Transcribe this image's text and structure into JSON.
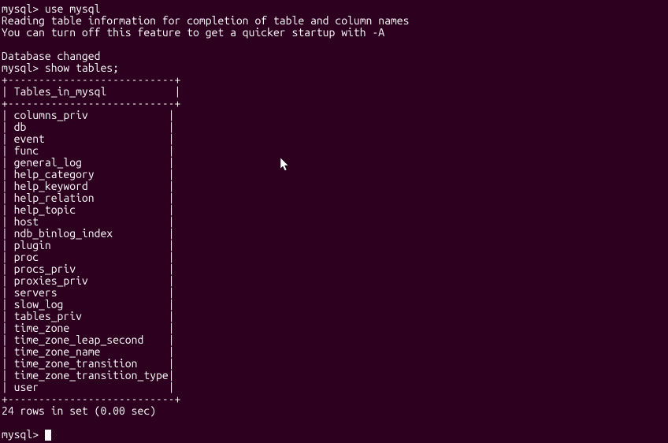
{
  "lines": {
    "prompt_use": "mysql> ",
    "command_use": "use mysql",
    "reading_info": "Reading table information for completion of table and column names",
    "turn_off_info": "You can turn off this feature to get a quicker startup with -A",
    "database_changed": "Database changed",
    "prompt_show": "mysql> ",
    "command_show": "show tables;",
    "border": "+---------------------------+",
    "header_prefix": "| ",
    "header_label": "Tables_in_mysql",
    "header_suffix": "           |",
    "rows": [
      "columns_priv",
      "db",
      "event",
      "func",
      "general_log",
      "help_category",
      "help_keyword",
      "help_relation",
      "help_topic",
      "host",
      "ndb_binlog_index",
      "plugin",
      "proc",
      "procs_priv",
      "proxies_priv",
      "servers",
      "slow_log",
      "tables_priv",
      "time_zone",
      "time_zone_leap_second",
      "time_zone_name",
      "time_zone_transition",
      "time_zone_transition_type",
      "user"
    ],
    "result_summary": "24 rows in set (0.00 sec)",
    "prompt_final": "mysql> "
  },
  "table_column_width": 27
}
